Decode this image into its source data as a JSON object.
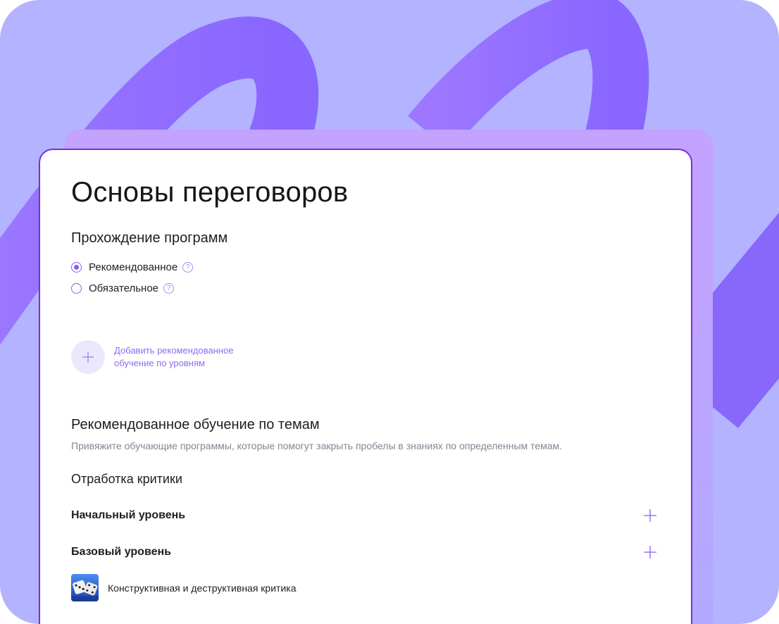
{
  "page": {
    "title": "Основы переговоров",
    "program_section": {
      "heading": "Прохождение программ",
      "options": [
        {
          "label": "Рекомендованное",
          "selected": true,
          "help_icon": "question-circle-icon"
        },
        {
          "label": "Обязательное",
          "selected": false,
          "help_icon": "question-circle-icon"
        }
      ]
    },
    "add_level": {
      "icon": "plus-icon",
      "line1": "Добавить рекомендованное",
      "line2": "обучение по уровням"
    },
    "topics_section": {
      "heading": "Рекомендованное обучение по темам",
      "description": "Привяжите обучающие программы, которые помогут закрыть пробелы в знаниях по определенным темам.",
      "topic_title": "Отработка критики",
      "levels": [
        {
          "label": "Начальный уровень",
          "add_icon": "plus-icon"
        },
        {
          "label": "Базовый уровень",
          "add_icon": "plus-icon"
        }
      ],
      "courses": [
        {
          "label": "Конструктивная и деструктивная критика",
          "thumbnail": "dice-image"
        }
      ]
    }
  },
  "colors": {
    "background": "#b3b3ff",
    "accent": "#8a5cf6",
    "card_border": "#7a2ee0",
    "ribbon": "#9a74ff"
  }
}
